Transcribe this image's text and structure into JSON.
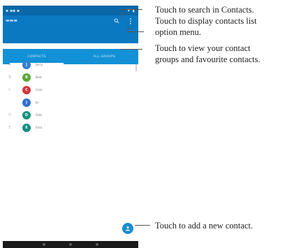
{
  "callouts": {
    "search": "Touch to search in Contacts.",
    "options_line1": "Touch to display contacts list",
    "options_line2": "option menu.",
    "groups_line1": "Touch to view your contact",
    "groups_line2": "groups and favourite contacts.",
    "add": "Touch to add a new contact."
  },
  "phone": {
    "tabs": [
      {
        "label": "CONTACTS",
        "active": true
      },
      {
        "label": "ALL GROUPS",
        "active": false
      }
    ],
    "contacts": [
      {
        "letter": "A",
        "initial": "J",
        "name": "Jerry",
        "color": "#2f7fd0"
      },
      {
        "letter": "B",
        "initial": "B",
        "name": "Bob",
        "color": "#57a63a"
      },
      {
        "letter": "C",
        "initial": "C",
        "name": "Cole",
        "color": "#d0363a"
      },
      {
        "letter": "",
        "initial": "J",
        "name": "Jo",
        "color": "#2f6fd0"
      },
      {
        "letter": "D",
        "initial": "D",
        "name": "Deb",
        "color": "#17927a"
      },
      {
        "letter": "E",
        "initial": "E",
        "name": "Elsa",
        "color": "#148e7f"
      }
    ],
    "colors": {
      "app_bar": "#0b78c2",
      "tab_bar": "#1391d6",
      "fab": "#1a8dd1"
    },
    "icons": [
      "search-icon",
      "more-vert-icon",
      "add-contact-icon"
    ]
  }
}
